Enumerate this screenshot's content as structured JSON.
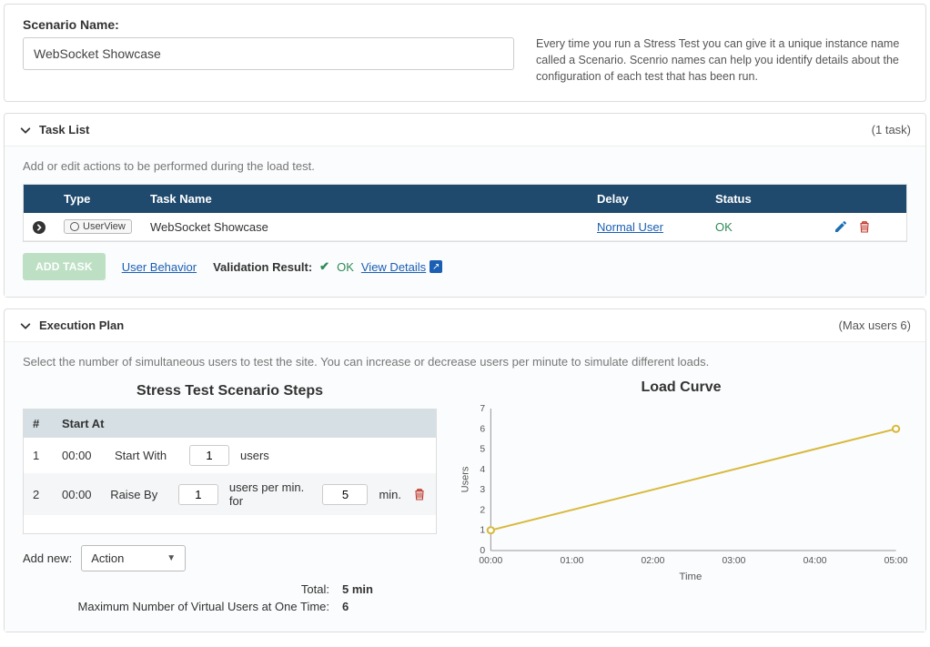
{
  "scenario": {
    "label": "Scenario Name:",
    "value": "WebSocket Showcase",
    "help": "Every time you run a Stress Test you can give it a unique instance name called a Scenario. Scenrio names can help you identify details about the configuration of each test that has been run."
  },
  "taskList": {
    "title": "Task List",
    "count": "(1 task)",
    "hint": "Add or edit actions to be performed during the load test.",
    "columns": {
      "type": "Type",
      "name": "Task Name",
      "delay": "Delay",
      "status": "Status"
    },
    "rows": [
      {
        "badge": "UserView",
        "name": "WebSocket Showcase",
        "delay": "Normal User",
        "status": "OK"
      }
    ],
    "addTask": "ADD TASK",
    "userBehavior": "User Behavior",
    "validationLabel": "Validation Result:",
    "validationStatus": "OK",
    "viewDetails": "View Details"
  },
  "execPlan": {
    "title": "Execution Plan",
    "count": "(Max users 6)",
    "hint": "Select the number of simultaneous users to test the site. You can increase or decrease users per minute to simulate different loads.",
    "stepsTitle": "Stress Test Scenario Steps",
    "columns": {
      "num": "#",
      "startAt": "Start At"
    },
    "steps": [
      {
        "n": "1",
        "startAt": "00:00",
        "action": "Start With",
        "v1": "1",
        "unit1": "users"
      },
      {
        "n": "2",
        "startAt": "00:00",
        "action": "Raise By",
        "v1": "1",
        "unit1": "users per min. for",
        "v2": "5",
        "unit2": "min."
      }
    ],
    "addNewLabel": "Add new:",
    "actionSelect": "Action",
    "totals": {
      "totalLabel": "Total:",
      "totalValue": "5 min",
      "maxLabel": "Maximum Number of Virtual Users at One Time:",
      "maxValue": "6"
    }
  },
  "chart_data": {
    "type": "line",
    "title": "Load Curve",
    "xlabel": "Time",
    "ylabel": "Users",
    "x_ticks": [
      "00:00",
      "01:00",
      "02:00",
      "03:00",
      "04:00",
      "05:00"
    ],
    "y_ticks": [
      0,
      1,
      2,
      3,
      4,
      5,
      6,
      7
    ],
    "ylim": [
      0,
      7
    ],
    "series": [
      {
        "name": "users",
        "points": [
          {
            "x": "00:00",
            "y": 1
          },
          {
            "x": "05:00",
            "y": 6
          }
        ]
      }
    ]
  }
}
